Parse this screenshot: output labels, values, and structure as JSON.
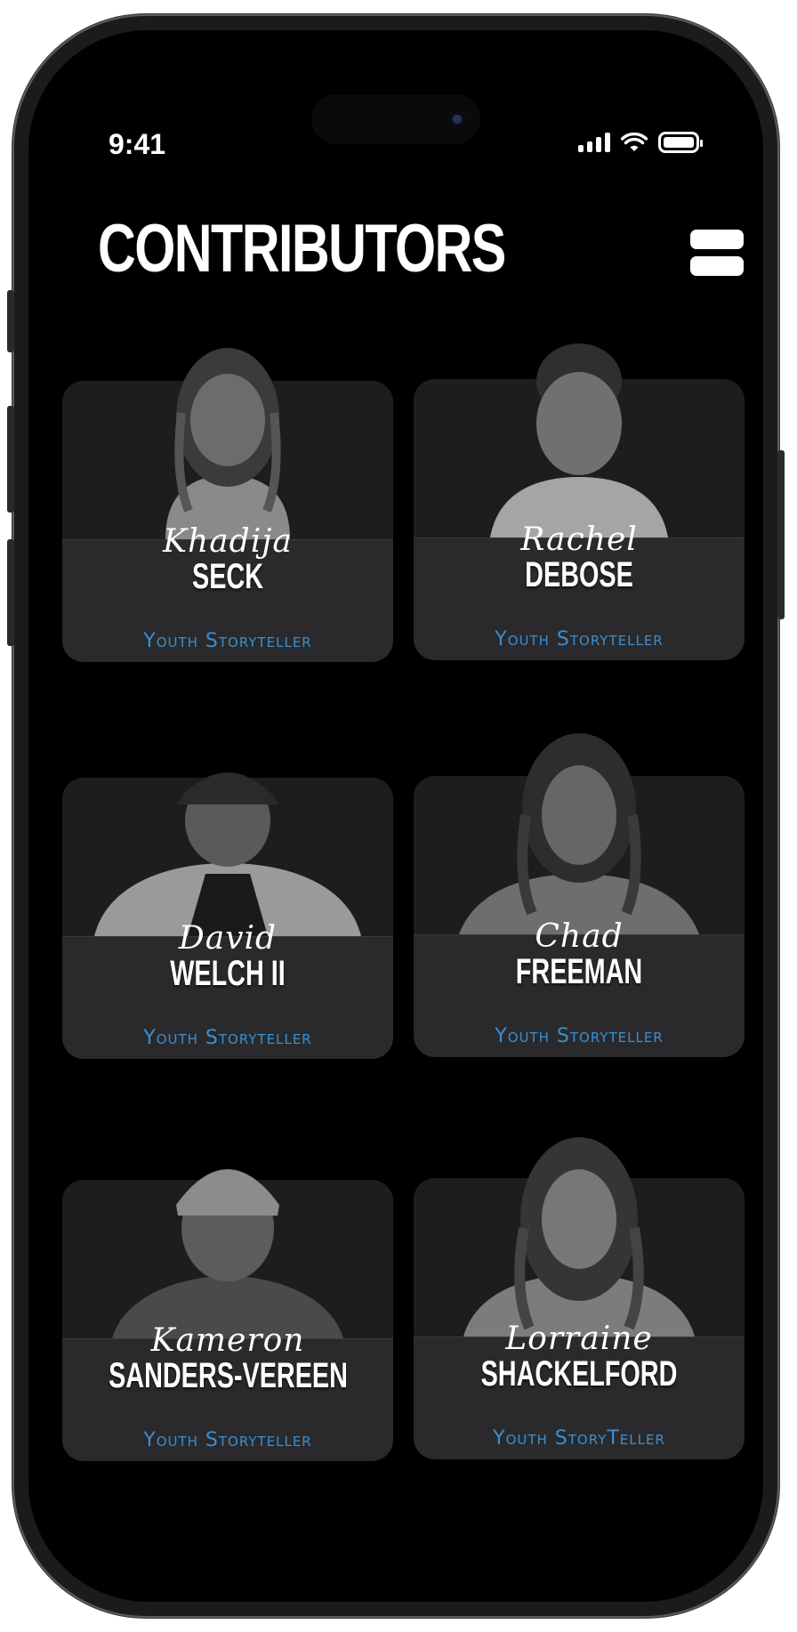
{
  "status_bar": {
    "time": "9:41"
  },
  "header": {
    "title": "CONTRIBUTORS"
  },
  "contributors": [
    {
      "first": "Khadija",
      "last": "SECK",
      "role": "Youth Storyteller"
    },
    {
      "first": "Rachel",
      "last": "DEBOSE",
      "role": "Youth Storyteller"
    },
    {
      "first": "David",
      "last": "WELCH II",
      "role": "Youth Storyteller"
    },
    {
      "first": "Chad",
      "last": "FREEMAN",
      "role": "Youth Storyteller"
    },
    {
      "first": "Kameron",
      "last": "SANDERS-VEREEN",
      "role": "Youth Storyteller"
    },
    {
      "first": "Lorraine",
      "last": "SHACKELFORD",
      "role": "Youth StoryTeller"
    }
  ],
  "colors": {
    "background": "#000000",
    "card": "#2a2a2c",
    "accent": "#3a8fd2"
  },
  "icons": {
    "menu": "menu-icon",
    "signal": "cellular-signal-icon",
    "wifi": "wifi-icon",
    "battery": "battery-icon"
  }
}
